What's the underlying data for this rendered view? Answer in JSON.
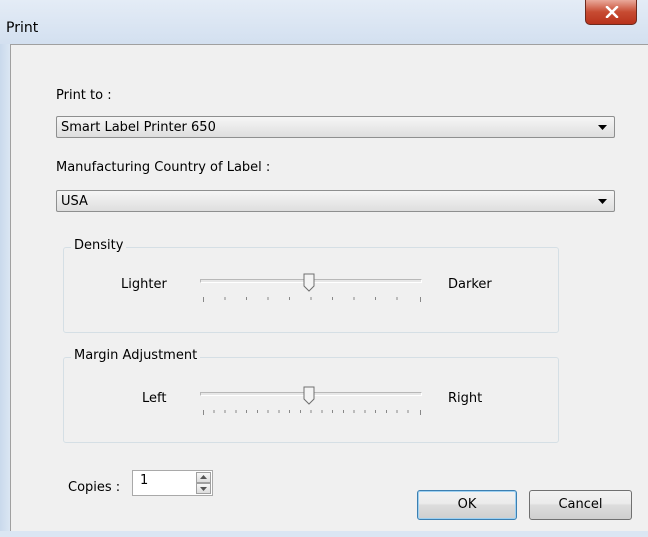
{
  "window": {
    "title": "Print",
    "close_icon": "close-x-icon"
  },
  "print_to": {
    "label": "Print to :",
    "selected": "Smart Label Printer 650"
  },
  "country": {
    "label": "Manufacturing Country of Label :",
    "selected": "USA"
  },
  "density": {
    "title": "Density",
    "min_label": "Lighter",
    "max_label": "Darker",
    "level_fraction": 0.5
  },
  "margin": {
    "title": "Margin Adjustment",
    "min_label": "Left",
    "max_label": "Right",
    "level_fraction": 0.5
  },
  "copies": {
    "label": "Copies :",
    "value": "1"
  },
  "buttons": {
    "ok": "OK",
    "cancel": "Cancel"
  },
  "colors": {
    "close_button": "#c74b32",
    "title_bar": "#d3e0f0",
    "default_button_border": "#3c7fb1"
  }
}
